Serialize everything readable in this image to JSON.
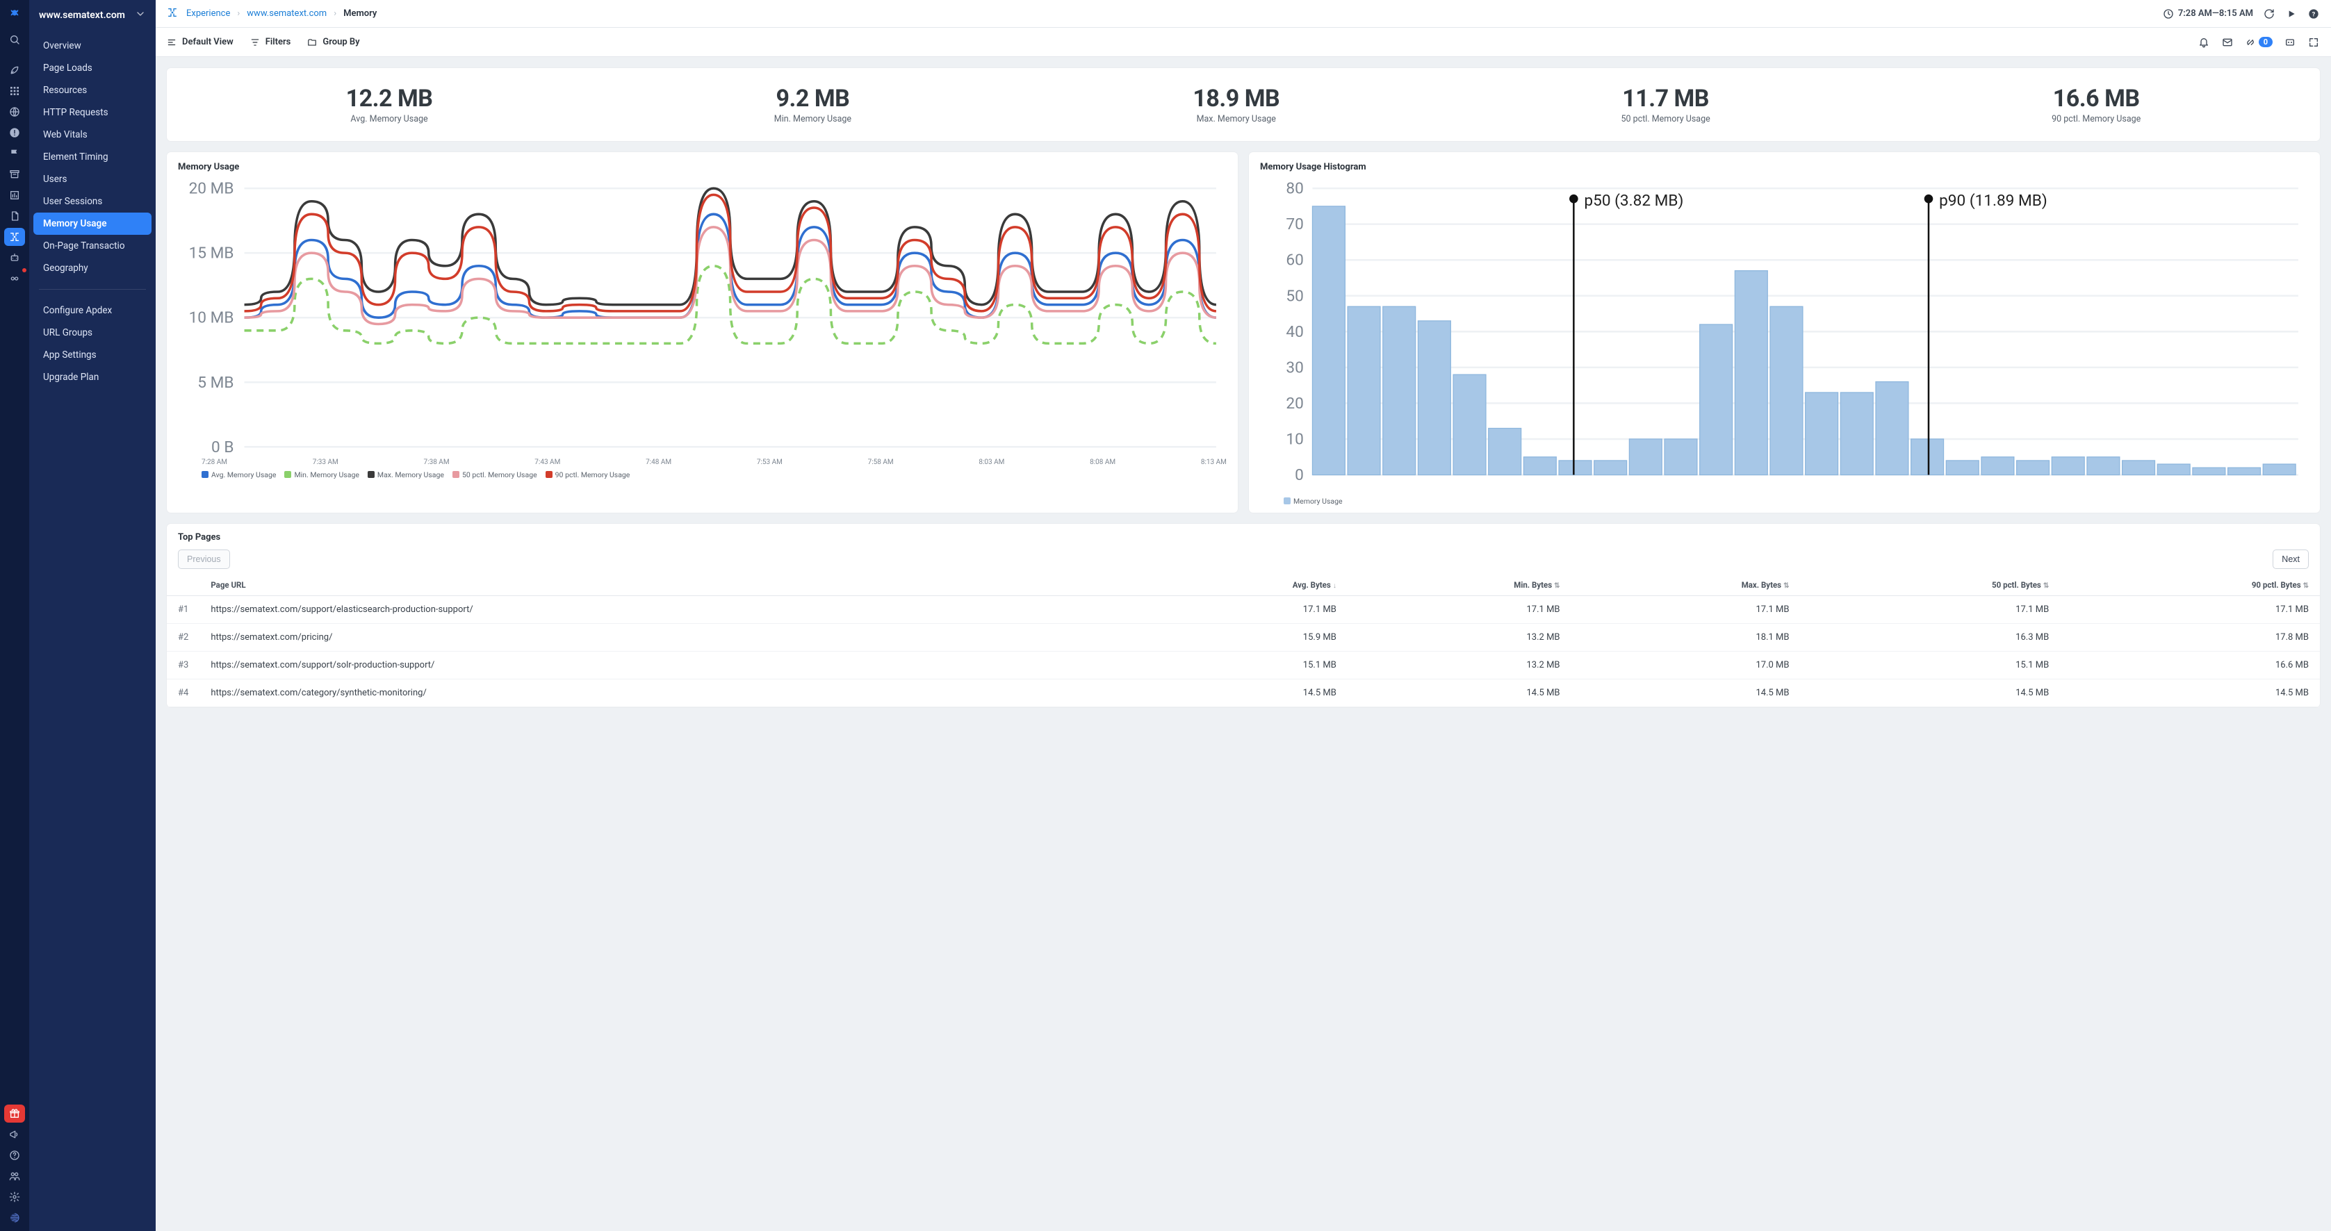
{
  "domain_label": "www.sematext.com",
  "breadcrumbs": {
    "root": "Experience",
    "mid": "www.sematext.com",
    "cur": "Memory"
  },
  "time_range": "7:28 AM—8:15 AM",
  "toolbar": {
    "default_view": "Default View",
    "filters": "Filters",
    "group_by": "Group By",
    "alert_badge": "0"
  },
  "sidebar": {
    "items": [
      "Overview",
      "Page Loads",
      "Resources",
      "HTTP Requests",
      "Web Vitals",
      "Element Timing",
      "Users",
      "User Sessions",
      "Memory Usage",
      "On-Page Transactio",
      "Geography"
    ],
    "selected_index": 8,
    "config": [
      "Configure Apdex",
      "URL Groups",
      "App Settings",
      "Upgrade Plan"
    ]
  },
  "kpis": [
    {
      "value": "12.2 MB",
      "label": "Avg. Memory Usage"
    },
    {
      "value": "9.2 MB",
      "label": "Min. Memory Usage"
    },
    {
      "value": "18.9 MB",
      "label": "Max. Memory Usage"
    },
    {
      "value": "11.7 MB",
      "label": "50 pctl. Memory Usage"
    },
    {
      "value": "16.6 MB",
      "label": "90 pctl. Memory Usage"
    }
  ],
  "chart_data": [
    {
      "type": "line",
      "title": "Memory Usage",
      "ylabel": "",
      "xlabel": "",
      "ylim": [
        0,
        20
      ],
      "y_ticks": [
        "20 MB",
        "15 MB",
        "10 MB",
        "5 MB",
        "0 B"
      ],
      "x_ticks": [
        "7:28 AM",
        "7:33 AM",
        "7:38 AM",
        "7:43 AM",
        "7:48 AM",
        "7:53 AM",
        "7:58 AM",
        "8:03 AM",
        "8:08 AM",
        "8:13 AM"
      ],
      "legend": [
        "Avg. Memory Usage",
        "Min. Memory Usage",
        "Max. Memory Usage",
        "50 pctl. Memory Usage",
        "90 pctl. Memory Usage"
      ],
      "legend_colors": [
        "#2f6fd0",
        "#8ad06a",
        "#3a3a3a",
        "#e79aa0",
        "#d23c2a"
      ],
      "series": [
        {
          "name": "Avg. Memory Usage",
          "color": "#2f6fd0",
          "values": [
            10,
            11,
            16,
            13,
            10,
            12,
            11,
            14,
            11,
            10,
            10.5,
            10,
            10,
            10,
            18,
            11,
            11,
            17,
            11,
            11,
            15,
            12,
            10,
            15,
            11,
            11,
            15,
            11,
            16,
            10
          ]
        },
        {
          "name": "Min. Memory Usage",
          "color": "#8ad06a",
          "dash": true,
          "values": [
            9,
            9,
            13,
            9,
            8,
            9,
            8,
            10,
            8,
            8,
            8,
            8,
            8,
            8,
            14,
            8,
            8,
            13,
            8,
            8,
            12,
            9,
            8,
            11,
            8,
            8,
            11,
            8,
            12,
            8
          ]
        },
        {
          "name": "Max. Memory Usage",
          "color": "#3a3a3a",
          "values": [
            11,
            12,
            19,
            16,
            12,
            16,
            14,
            18,
            13,
            11,
            11.5,
            11,
            11,
            11,
            20,
            13,
            13,
            19,
            12,
            12,
            17,
            14,
            11,
            18,
            12,
            12,
            18,
            12,
            19,
            11
          ]
        },
        {
          "name": "50 pctl. Memory Usage",
          "color": "#e79aa0",
          "values": [
            10,
            10.5,
            15,
            12,
            9.5,
            11,
            10.5,
            13,
            10.5,
            10,
            10,
            10,
            10,
            10,
            17,
            10.5,
            10.5,
            16,
            10.5,
            10.5,
            14,
            11,
            10,
            14,
            10.5,
            10.5,
            14,
            10.5,
            15,
            10
          ]
        },
        {
          "name": "90 pctl. Memory Usage",
          "color": "#d23c2a",
          "values": [
            10.5,
            11.5,
            18,
            15,
            11,
            15,
            13,
            17,
            12,
            10.5,
            11,
            10.5,
            10.5,
            10.5,
            19.5,
            12,
            12,
            18.5,
            11.5,
            11.5,
            16,
            13,
            10.5,
            17,
            11.5,
            11.5,
            17,
            11.5,
            18,
            10.5
          ]
        }
      ]
    },
    {
      "type": "bar",
      "title": "Memory Usage Histogram",
      "ylabel": "",
      "xlabel": "",
      "ylim": [
        0,
        80
      ],
      "y_ticks": [
        "80",
        "70",
        "60",
        "50",
        "40",
        "30",
        "20",
        "10",
        "0"
      ],
      "legend": [
        "Memory Usage"
      ],
      "legend_colors": [
        "#a7c7e7"
      ],
      "annotations": [
        {
          "pos": 0.265,
          "label": "p50 (3.82 MB)"
        },
        {
          "pos": 0.625,
          "label": "p90 (11.89 MB)"
        }
      ],
      "values": [
        75,
        47,
        47,
        43,
        28,
        13,
        5,
        4,
        4,
        10,
        10,
        42,
        57,
        47,
        23,
        23,
        26,
        10,
        4,
        5,
        4,
        5,
        5,
        4,
        3,
        2,
        2,
        3
      ]
    }
  ],
  "table": {
    "title": "Top Pages",
    "prev": "Previous",
    "next": "Next",
    "columns": [
      "",
      "Page URL",
      "Avg. Bytes",
      "Min. Bytes",
      "Max. Bytes",
      "50 pctl. Bytes",
      "90 pctl. Bytes"
    ],
    "sort_col": 2,
    "sort_dir": "desc",
    "rows": [
      {
        "rank": "#1",
        "url": "https://sematext.com/support/elasticsearch-production-support/",
        "avg": "17.1 MB",
        "min": "17.1 MB",
        "max": "17.1 MB",
        "p50": "17.1 MB",
        "p90": "17.1 MB"
      },
      {
        "rank": "#2",
        "url": "https://sematext.com/pricing/",
        "avg": "15.9 MB",
        "min": "13.2 MB",
        "max": "18.1 MB",
        "p50": "16.3 MB",
        "p90": "17.8 MB"
      },
      {
        "rank": "#3",
        "url": "https://sematext.com/support/solr-production-support/",
        "avg": "15.1 MB",
        "min": "13.2 MB",
        "max": "17.0 MB",
        "p50": "15.1 MB",
        "p90": "16.6 MB"
      },
      {
        "rank": "#4",
        "url": "https://sematext.com/category/synthetic-monitoring/",
        "avg": "14.5 MB",
        "min": "14.5 MB",
        "max": "14.5 MB",
        "p50": "14.5 MB",
        "p90": "14.5 MB"
      }
    ]
  }
}
